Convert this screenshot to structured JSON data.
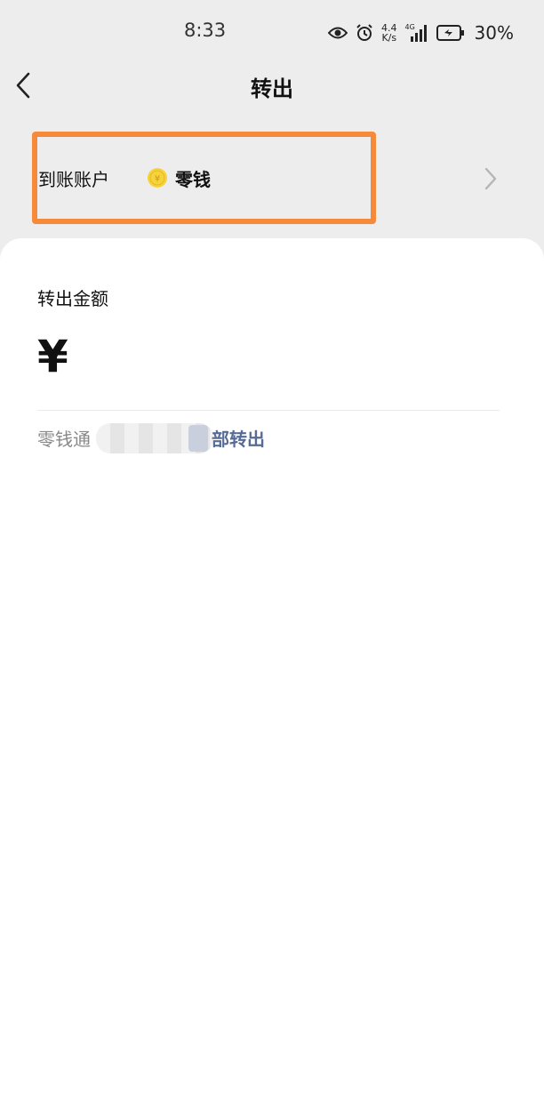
{
  "status_bar": {
    "time": "8:33",
    "net_speed_value": "4.4",
    "net_speed_unit": "K/s",
    "signal_type": "4G",
    "battery": "30%"
  },
  "nav": {
    "title": "转出"
  },
  "account": {
    "label": "到账账户",
    "value": "零钱",
    "coin_symbol": "¥"
  },
  "amount": {
    "label": "转出金额",
    "currency": "¥"
  },
  "balance": {
    "prefix": "零钱通",
    "link_text": "部转出"
  },
  "colors": {
    "highlight": "#f58a3a",
    "link": "#576b95",
    "background": "#ededed",
    "coin": "#f6d33c"
  }
}
